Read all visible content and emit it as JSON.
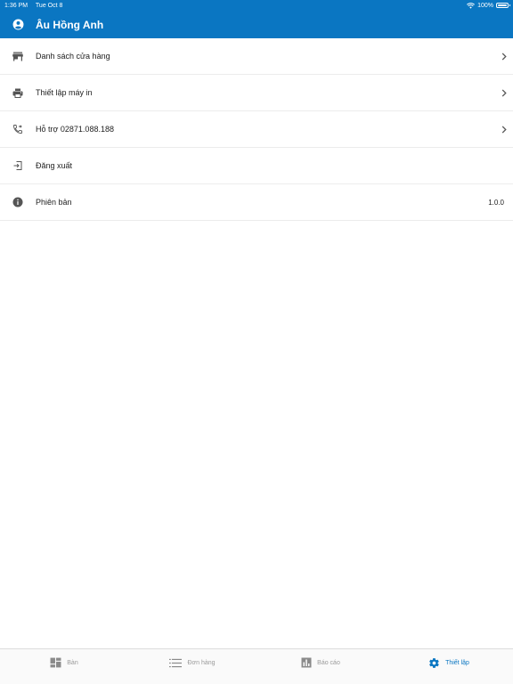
{
  "status_bar": {
    "time": "1:36 PM",
    "date": "Tue Oct 8",
    "battery": "100%"
  },
  "header": {
    "title": "Âu Hồng Anh"
  },
  "menu": {
    "items": [
      {
        "label": "Danh sách cửa hàng",
        "icon": "store-icon",
        "has_chevron": true
      },
      {
        "label": "Thiết lập máy in",
        "icon": "printer-icon",
        "has_chevron": true
      },
      {
        "label": "Hỗ trợ 02871.088.188",
        "icon": "phone-forward-icon",
        "has_chevron": true
      },
      {
        "label": "Đăng xuất",
        "icon": "logout-icon",
        "has_chevron": false
      },
      {
        "label": "Phiên bản",
        "icon": "info-icon",
        "value": "1.0.0"
      }
    ]
  },
  "tabs": [
    {
      "label": "Bàn",
      "icon": "tables-icon",
      "active": false
    },
    {
      "label": "Đơn hàng",
      "icon": "list-icon",
      "active": false
    },
    {
      "label": "Báo cáo",
      "icon": "bar-chart-icon",
      "active": false
    },
    {
      "label": "Thiết lập",
      "icon": "gear-icon",
      "active": true
    }
  ],
  "colors": {
    "primary": "#0a76c2",
    "icon_gray": "#555555",
    "tab_inactive": "#9a9a9a"
  }
}
